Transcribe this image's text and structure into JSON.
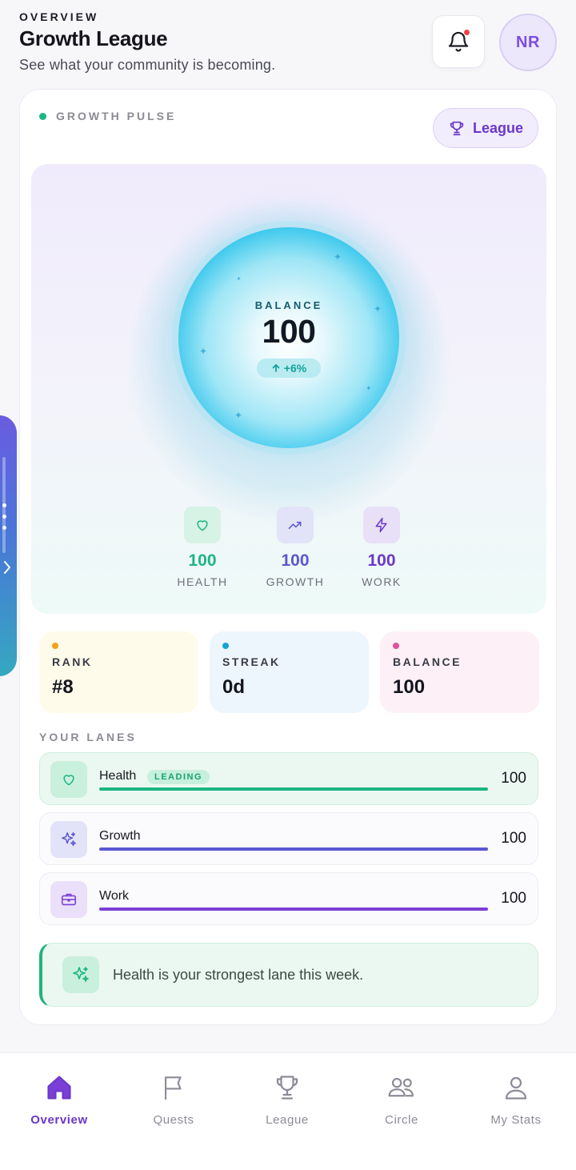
{
  "header": {
    "eyebrow": "OVERVIEW",
    "title": "Growth League",
    "subtitle": "See what your community is becoming.",
    "avatar_initials": "NR"
  },
  "pulse": {
    "label": "GROWTH PULSE",
    "league_button": "League",
    "orb": {
      "label": "BALANCE",
      "value": "100",
      "change": "+6%"
    },
    "metrics": [
      {
        "value": "100",
        "label": "HEALTH",
        "icon": "heart-icon",
        "color": "#1db584"
      },
      {
        "value": "100",
        "label": "GROWTH",
        "icon": "trending-up-icon",
        "color": "#5b57d1"
      },
      {
        "value": "100",
        "label": "WORK",
        "icon": "lightning-icon",
        "color": "#6a38c9"
      }
    ]
  },
  "tiles": [
    {
      "label": "RANK",
      "value": "#8",
      "dot_color": "#f0a21b",
      "bg": "#fffbea"
    },
    {
      "label": "STREAK",
      "value": "0d",
      "dot_color": "#17a2d8",
      "bg": "#eef6fd"
    },
    {
      "label": "BALANCE",
      "value": "100",
      "dot_color": "#e0529a",
      "bg": "#fdf0f6"
    }
  ],
  "lanes": {
    "label": "YOUR LANES",
    "items": [
      {
        "name": "Health",
        "badge": "LEADING",
        "value": "100",
        "progress": 1.0,
        "bar_color": "#1db584",
        "icon": "heart-icon"
      },
      {
        "name": "Growth",
        "value": "100",
        "progress": 1.0,
        "bar_color": "#5b57d1",
        "icon": "sparkles-icon"
      },
      {
        "name": "Work",
        "value": "100",
        "progress": 1.0,
        "bar_color": "#7a3fd6",
        "icon": "briefcase-icon"
      }
    ]
  },
  "insight": {
    "text": "Health is your strongest lane this week.",
    "icon": "sparkles-icon"
  },
  "nav": {
    "items": [
      {
        "label": "Overview",
        "icon": "home-icon",
        "active": true
      },
      {
        "label": "Quests",
        "icon": "flag-icon",
        "active": false
      },
      {
        "label": "League",
        "icon": "trophy-icon",
        "active": false
      },
      {
        "label": "Circle",
        "icon": "people-icon",
        "active": false
      },
      {
        "label": "My Stats",
        "icon": "person-icon",
        "active": false
      }
    ]
  },
  "colors": {
    "accent": "#6a38c9",
    "health": "#1db584",
    "growth": "#5b57d1",
    "work": "#7a3fd6"
  }
}
